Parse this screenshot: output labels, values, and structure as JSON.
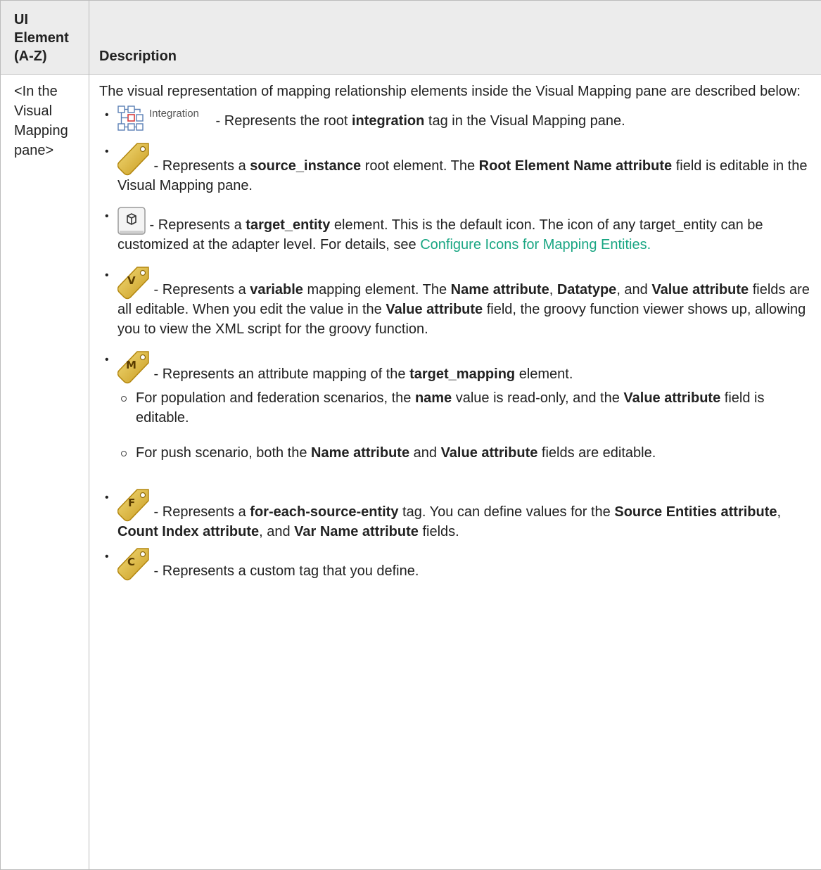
{
  "table": {
    "headers": [
      "UI Element (A-Z)",
      "Description"
    ],
    "row_label": "<In the Visual Mapping pane>",
    "intro": "The visual representation of mapping relationship elements inside the Visual Mapping pane are described below:"
  },
  "items": {
    "integration": {
      "icon_label": "Integration",
      "t1": " - Represents the root ",
      "b1": "integration",
      "t2": " tag in the Visual Mapping pane."
    },
    "source": {
      "t1": " - Represents a ",
      "b1": "source_instance",
      "t2": " root element. The ",
      "b2": "Root Element Name attribute",
      "t3": " field is editable in the Visual Mapping pane."
    },
    "target": {
      "t1": " - Represents a ",
      "b1": "target_entity",
      "t2": " element. This is the default icon. The icon of any target_entity can be customized at the adapter level. For details, see ",
      "link": "Configure Icons for Mapping Entities."
    },
    "variable": {
      "badge": "V",
      "t1": " - Represents a ",
      "b1": "variable",
      "t2": " mapping element. The ",
      "b2": "Name attribute",
      "t3": ", ",
      "b3": "Datatype",
      "t4": ", and ",
      "b4": "Value attribute",
      "t5": " fields are all editable. When you edit the value in the ",
      "b5": "Value attribute",
      "t6": " field, the groovy function viewer shows up, allowing you to view the XML script for the groovy function."
    },
    "mapping": {
      "badge": "M",
      "t1": " - Represents an attribute mapping of the ",
      "b1": "target_mapping",
      "t2": " element.",
      "sub1": {
        "t1": "For population and federation scenarios, the ",
        "b1": "name",
        "t2": " value is read-only, and the ",
        "b2": "Value attribute",
        "t3": " field is editable."
      },
      "sub2": {
        "t1": "For push scenario, both the ",
        "b1": "Name attribute",
        "t2": " and ",
        "b2": "Value attribute",
        "t3": " fields are editable."
      }
    },
    "foreach": {
      "badge": "F",
      "t1": " - Represents a ",
      "b1": "for-each-source-entity",
      "t2": " tag. You can define values for the ",
      "b2": "Source Entities attribute",
      "t3": ", ",
      "b3": "Count Index attribute",
      "t4": ", and ",
      "b4": "Var Name attribute",
      "t5": " fields."
    },
    "custom": {
      "badge": "C",
      "t1": " - Represents a custom tag that you define."
    }
  },
  "colors": {
    "link": "#1aa683",
    "header_bg": "#ececec",
    "tag_gold": "#e8c24a"
  }
}
